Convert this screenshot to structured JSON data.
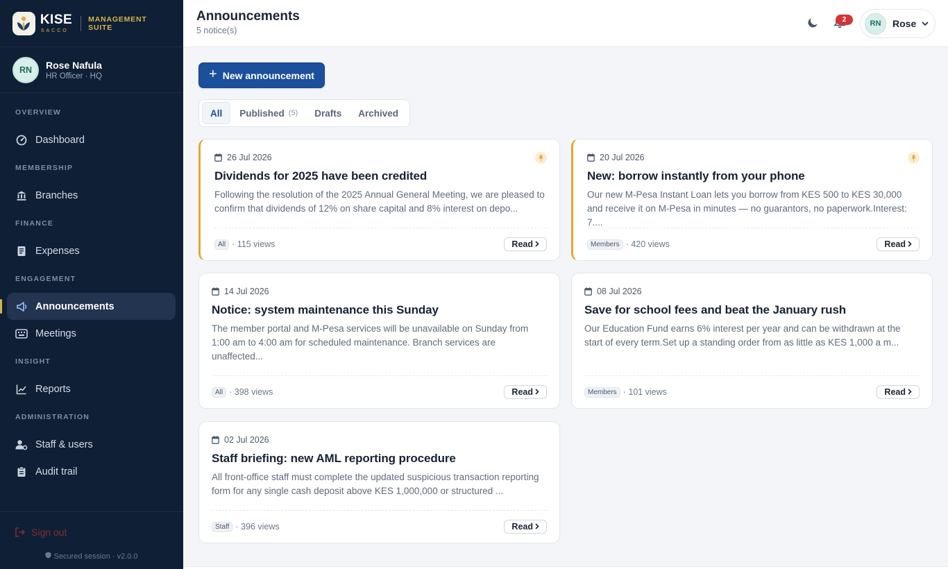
{
  "brand": {
    "name": "KISE",
    "sub": "SACCO",
    "suite": "MANAGEMENT SUITE"
  },
  "user": {
    "initials": "RN",
    "name": "Rose Nafula",
    "role": "HR Officer · HQ",
    "short_name": "Rose"
  },
  "nav": {
    "sections": {
      "overview": "OVERVIEW",
      "membership": "MEMBERSHIP",
      "finance": "FINANCE",
      "engagement": "ENGAGEMENT",
      "insight": "INSIGHT",
      "administration": "ADMINISTRATION"
    },
    "items": {
      "dashboard": "Dashboard",
      "branches": "Branches",
      "expenses": "Expenses",
      "announcements": "Announcements",
      "meetings": "Meetings",
      "reports": "Reports",
      "staff": "Staff & users",
      "audit": "Audit trail"
    }
  },
  "footer": {
    "signout": "Sign out",
    "secured": "Secured session · v2.0.0"
  },
  "header": {
    "title": "Announcements",
    "subtitle": "5 notice(s)",
    "notifications": "2"
  },
  "toolbar": {
    "new_label": "New announcement"
  },
  "tabs": {
    "all": "All",
    "published": "Published",
    "published_count": "(5)",
    "drafts": "Drafts",
    "archived": "Archived"
  },
  "read_label": "Read",
  "cards": [
    {
      "date": "26 Jul 2026",
      "title": "Dividends for 2025 have been credited",
      "body": "Following the resolution of the 2025 Annual General Meeting, we are pleased to confirm that dividends of 12% on share capital and 8% interest on depo...",
      "audience": "All",
      "views": "· 115 views"
    },
    {
      "date": "20 Jul 2026",
      "title": "New: borrow instantly from your phone",
      "body": "Our new M-Pesa Instant Loan lets you borrow from KES 500 to KES 30,000 and receive it on M-Pesa in minutes — no guarantors, no paperwork.Interest: 7....",
      "audience": "Members",
      "views": "· 420 views"
    },
    {
      "date": "14 Jul 2026",
      "title": "Notice: system maintenance this Sunday",
      "body": "The member portal and M-Pesa services will be unavailable on Sunday from 1:00 am to 4:00 am for scheduled maintenance. Branch services are unaffected...",
      "audience": "All",
      "views": "· 398 views"
    },
    {
      "date": "08 Jul 2026",
      "title": "Save for school fees and beat the January rush",
      "body": "Our Education Fund earns 6% interest per year and can be withdrawn at the start of every term.Set up a standing order from as little as KES 1,000 a m...",
      "audience": "Members",
      "views": "· 101 views"
    },
    {
      "date": "02 Jul 2026",
      "title": "Staff briefing: new AML reporting procedure",
      "body": "All front-office staff must complete the updated suspicious transaction reporting form for any single cash deposit above KES 1,000,000 or structured ...",
      "audience": "Staff",
      "views": "· 396 views"
    }
  ]
}
